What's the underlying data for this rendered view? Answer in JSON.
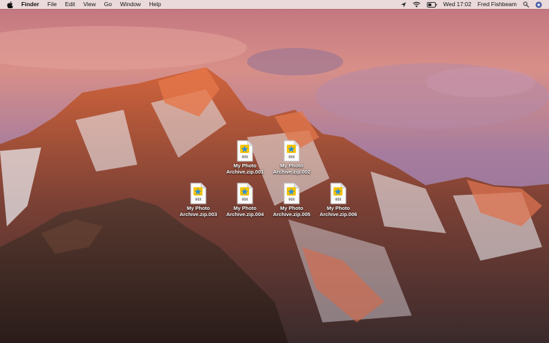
{
  "menubar": {
    "app_name": "Finder",
    "menus": [
      "File",
      "Edit",
      "View",
      "Go",
      "Window",
      "Help"
    ],
    "clock": "Wed 17:02",
    "user": "Fred Fishbeam",
    "icons": [
      "apple-icon",
      "location-arrow-icon",
      "wifi-icon",
      "battery-icon",
      "search-icon",
      "notification-center-icon"
    ]
  },
  "desktop": {
    "file_badge": "00X",
    "colors": {
      "file_accent": "#f2c200",
      "file_star": "#2f8fd8"
    },
    "files": [
      {
        "line1": "My Photo",
        "line2": "Archive.zip.001"
      },
      {
        "line1": "My Photo",
        "line2": "Archive.zip.002"
      },
      {
        "line1": "My Photo",
        "line2": "Archive.zip.003"
      },
      {
        "line1": "My Photo",
        "line2": "Archive.zip.004"
      },
      {
        "line1": "My Photo",
        "line2": "Archive.zip.005"
      },
      {
        "line1": "My Photo",
        "line2": "Archive.zip.006"
      }
    ]
  }
}
